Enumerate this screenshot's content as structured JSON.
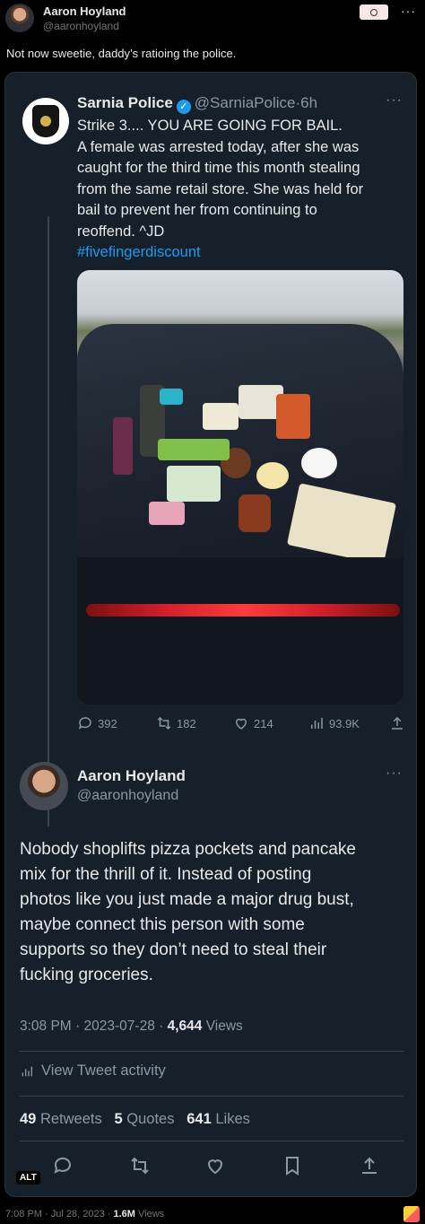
{
  "header": {
    "name": "Aaron Hoyland",
    "handle": "@aaronhoyland",
    "text": "Not now sweetie, daddy’s ratioing the police."
  },
  "quoted_tweet": {
    "name": "Sarnia Police",
    "handle": "@SarniaPolice",
    "separator": "·",
    "time": "6h",
    "lines": [
      "Strike 3.... YOU ARE GOING FOR BAIL.",
      "A female was arrested today, after she was",
      "caught for the third time this month stealing",
      "from the same retail store.  She was held for",
      "bail to prevent her from continuing to",
      "reoffend. ^JD"
    ],
    "hashtag": "#fivefingerdiscount",
    "actions": {
      "replies": "392",
      "retweets": "182",
      "likes": "214",
      "views": "93.9K"
    }
  },
  "main_tweet": {
    "name": "Aaron Hoyland",
    "handle": "@aaronhoyland",
    "lines": [
      "Nobody shoplifts pizza pockets and pancake",
      "mix for the thrill of it. Instead of posting",
      "photos like you just made a major drug bust,",
      "maybe connect this person with some",
      "supports so they don’t need to steal their",
      "fucking groceries."
    ],
    "time": "3:08 PM",
    "date": "2023-07-28",
    "dot": "·",
    "views_count": "4,644",
    "views_label": "Views",
    "activity_label": "View Tweet activity",
    "retweets_count": "49",
    "retweets_label": "Retweets",
    "quotes_count": "5",
    "quotes_label": "Quotes",
    "likes_count": "641",
    "likes_label": "Likes"
  },
  "alt_label": "ALT",
  "footer": {
    "time": "7:08 PM",
    "dot": "·",
    "date": "Jul 28, 2023",
    "views_count": "1.6M",
    "views_label": "Views"
  },
  "colors": {
    "card_bg": "#15202b",
    "accent": "#1d9bf0",
    "muted": "#8b98a5"
  }
}
